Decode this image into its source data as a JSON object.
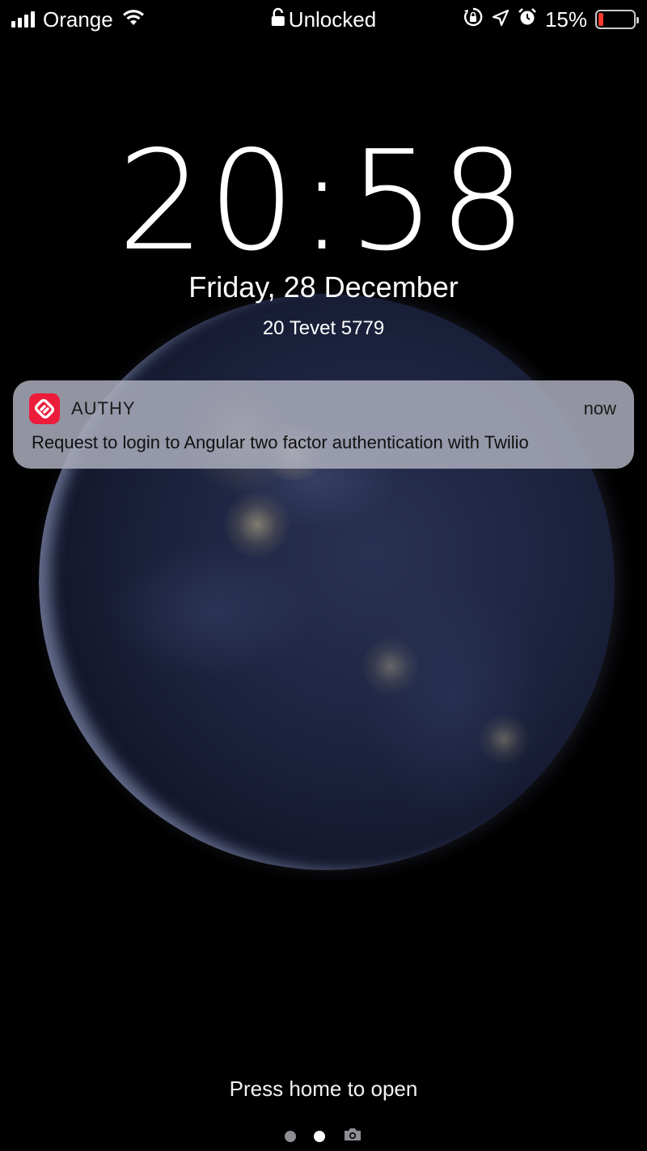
{
  "status_bar": {
    "carrier": "Orange",
    "lock_status": "Unlocked",
    "battery_percent": "15%",
    "battery_level": 0.15,
    "battery_color": "#ff3b30",
    "icons": [
      "signal-icon",
      "wifi-icon",
      "lock-icon",
      "rotation-lock-icon",
      "location-icon",
      "alarm-icon",
      "battery-icon"
    ]
  },
  "lock_screen": {
    "time": "20:58",
    "date": "Friday, 28 December",
    "alt_date": "20 Tevet 5779"
  },
  "notification": {
    "app_name": "AUTHY",
    "app_icon": "authy-icon",
    "app_color": "#ec1c3b",
    "time": "now",
    "message": "Request to login to Angular two factor authentication with Twilio"
  },
  "footer": {
    "hint": "Press home to open",
    "pages": [
      "dot",
      "dot-active",
      "camera-icon"
    ]
  }
}
